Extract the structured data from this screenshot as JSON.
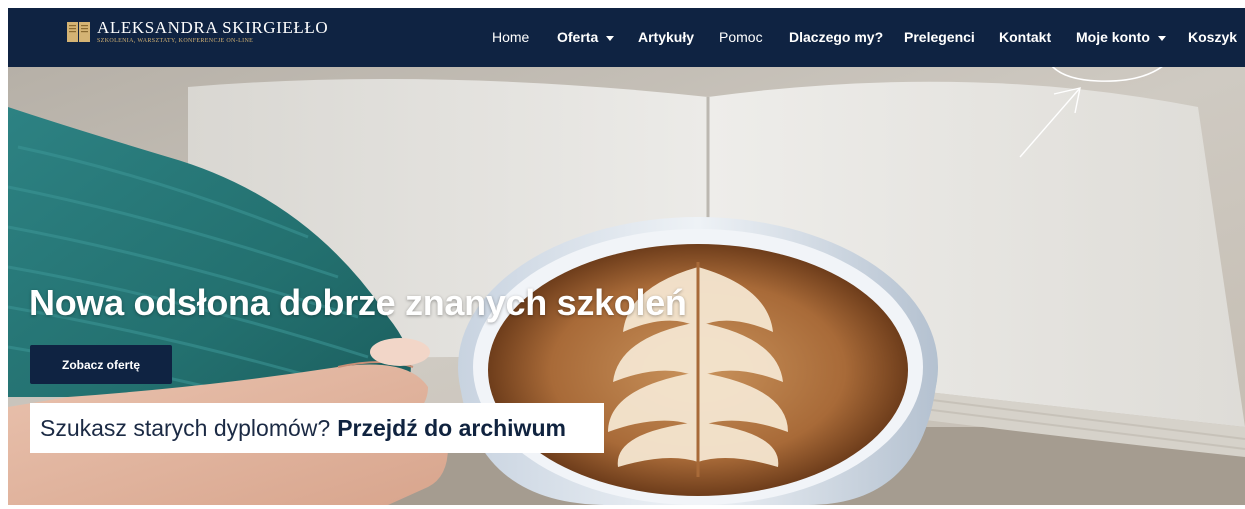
{
  "brand": {
    "name": "ALEKSANDRA SKIRGIEŁŁO",
    "tagline": "SZKOLENIA, WARSZTATY, KONFERENCJE ON-LINE",
    "icon": "open-book-icon",
    "accent_color": "#d4b374"
  },
  "nav": {
    "home": "Home",
    "offer": "Oferta",
    "articles": "Artykuły",
    "help": "Pomoc",
    "why_us": "Dlaczego my?",
    "speakers": "Prelegenci",
    "contact": "Kontakt",
    "account": "Moje konto",
    "cart": "Koszyk",
    "dropdown_icon": "caret-down-icon"
  },
  "hero": {
    "title": "Nowa odsłona dobrze znanych szkoleń",
    "button_label": "Zobacz ofertę",
    "archive_prompt": "Szukasz starych dyplomów?",
    "archive_link": "Przejdź do archiwum",
    "background": "knitted-sleeve-hand-latte-cup-open-book"
  },
  "annotation": {
    "description": "hand-drawn-circle-and-arrow-around-account-menu",
    "color": "#ffffff"
  },
  "colors": {
    "navbar_bg": "#0f2342",
    "button_bg": "#0f2342",
    "text_light": "#ffffff"
  }
}
